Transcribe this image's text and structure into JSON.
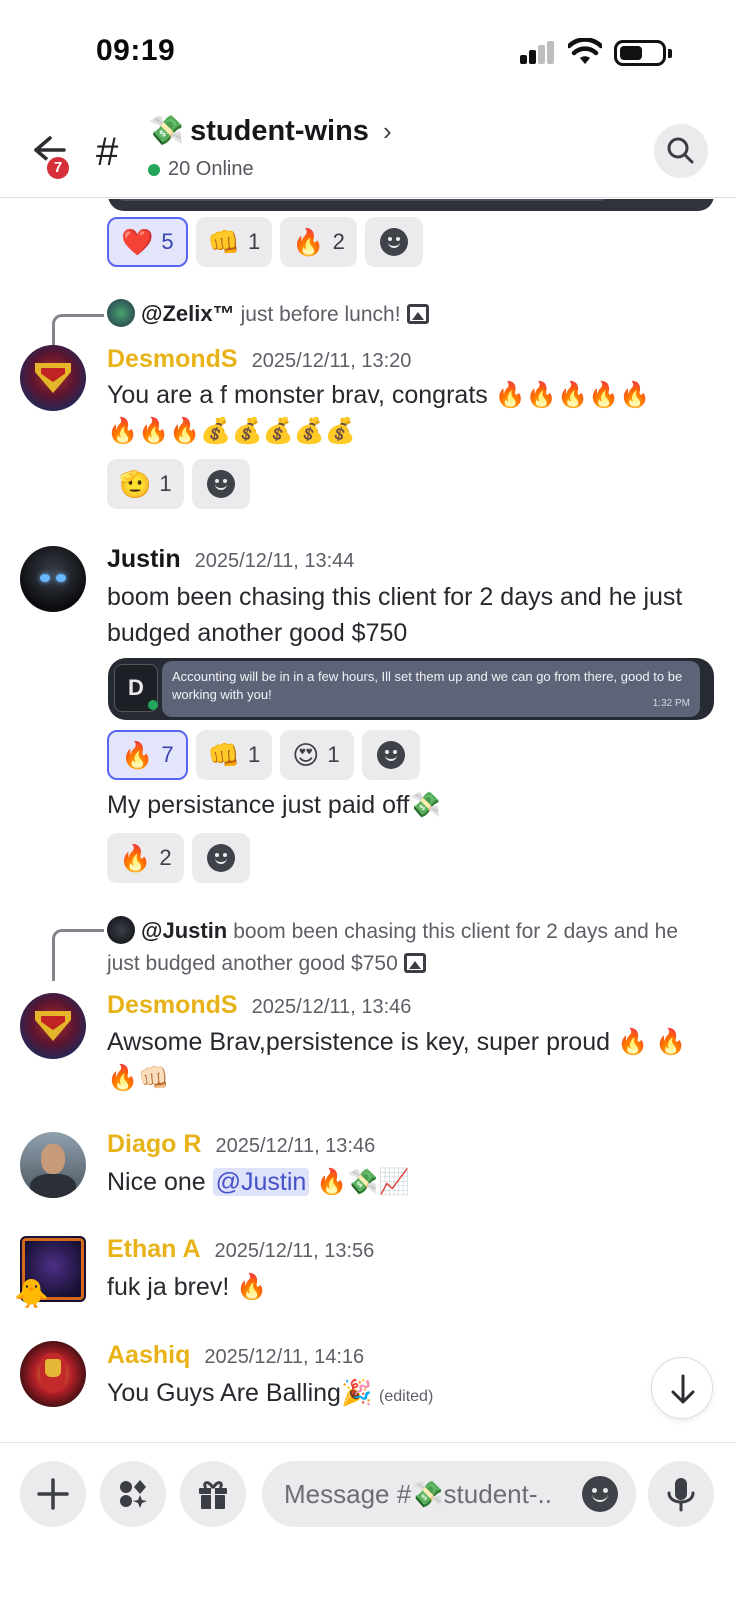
{
  "status": {
    "time": "09:19"
  },
  "header": {
    "badge": "7",
    "hash": "#",
    "channel_emoji": "💸",
    "channel_name": "student-wins",
    "chevron": "›",
    "online": "20 Online"
  },
  "top_reactions": [
    {
      "emoji": "❤️",
      "count": "5",
      "active": true
    },
    {
      "emoji": "👊",
      "count": "1",
      "active": false
    },
    {
      "emoji": "🔥",
      "count": "2",
      "active": false
    }
  ],
  "msg1": {
    "reply_to": "@Zelix™",
    "reply_text": "just before lunch!",
    "username": "DesmondS",
    "timestamp": "2025/12/11, 13:20",
    "text_line1": "You are a f monster brav, congrats 🔥🔥🔥🔥🔥",
    "text_line2": "🔥🔥🔥💰💰💰💰💰",
    "reactions": [
      {
        "emoji": "🫡",
        "count": "1"
      }
    ]
  },
  "msg2": {
    "username": "Justin",
    "timestamp": "2025/12/11, 13:44",
    "text": "boom been chasing this client for 2 days and he just budged another good $750",
    "embed": {
      "initial": "D",
      "text": "Accounting will be in in a few hours, Ill set them up and we can go from there, good to be working with you!",
      "time": "1:32 PM"
    },
    "reactions": [
      {
        "emoji": "🔥",
        "count": "7",
        "active": true
      },
      {
        "emoji": "👊",
        "count": "1",
        "active": false
      },
      {
        "emoji": "😍",
        "count": "1",
        "active": false
      }
    ],
    "followup": "My persistance just paid off💸",
    "followup_reactions": [
      {
        "emoji": "🔥",
        "count": "2"
      }
    ]
  },
  "msg3": {
    "reply_to": "@Justin",
    "reply_text": "boom been chasing this client for 2 days and he just budged another good $750",
    "username": "DesmondS",
    "timestamp": "2025/12/11, 13:46",
    "text": "Awsome Brav,persistence is key, super proud 🔥 🔥🔥👊🏻"
  },
  "msg4": {
    "username": "Diago R",
    "timestamp": "2025/12/11, 13:46",
    "text_before": "Nice one",
    "mention": "@Justin",
    "text_after": "🔥💸📈"
  },
  "msg5": {
    "username": "Ethan A",
    "timestamp": "2025/12/11, 13:56",
    "text": "fuk ja brev! 🔥",
    "decoration": "🐥"
  },
  "msg6": {
    "username": "Aashiq",
    "timestamp": "2025/12/11, 14:16",
    "text": "You Guys Are Balling🎉",
    "edited": "(edited)"
  },
  "composer": {
    "placeholder": "Message #💸student-.."
  },
  "colors": {
    "accent": "#5865f2",
    "username_gold": "#e8b319",
    "online_green": "#23a55a",
    "badge_red": "#d62f3a"
  },
  "icons": [
    "back-arrow-icon",
    "search-icon",
    "chevron-right-icon",
    "image-icon",
    "add-reaction-icon",
    "arrow-down-icon",
    "plus-icon",
    "apps-icon",
    "gift-icon",
    "emoji-icon",
    "microphone-icon"
  ]
}
